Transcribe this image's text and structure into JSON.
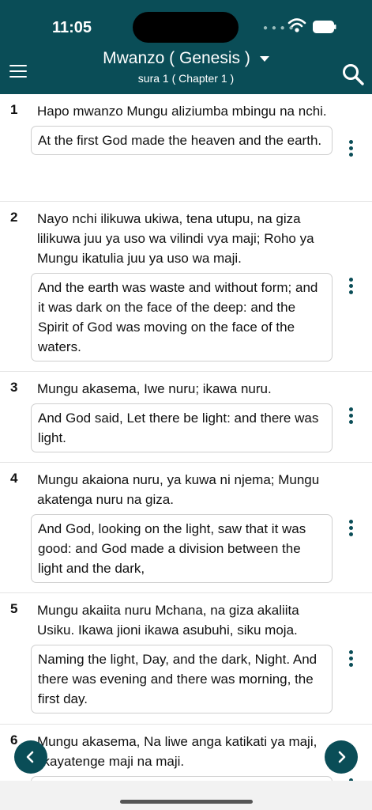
{
  "status": {
    "time": "11:05"
  },
  "header": {
    "book_title": "Mwanzo ( Genesis )",
    "chapter_subtitle": "sura 1 ( Chapter 1 )"
  },
  "icons": {
    "menu": "menu-icon",
    "dropdown": "chevron-down-icon",
    "search": "search-icon",
    "more": "more-vertical-icon",
    "prev": "chevron-left-icon",
    "next": "chevron-right-icon"
  },
  "colors": {
    "accent": "#0a4d57"
  },
  "verses": [
    {
      "num": "1",
      "swahili": "Hapo mwanzo Mungu aliziumba mbingu na nchi.",
      "english": "At the first God made the heaven and the earth."
    },
    {
      "num": "2",
      "swahili": "Nayo nchi ilikuwa ukiwa, tena utupu, na giza lilikuwa juu ya uso wa vilindi vya maji; Roho ya Mungu ikatulia juu ya uso wa maji.",
      "english": "And the earth was waste and without form; and it was dark on the face of the deep: and the Spirit of God was moving on the face of the waters."
    },
    {
      "num": "3",
      "swahili": "Mungu akasema, Iwe nuru; ikawa nuru.",
      "english": "And God said, Let there be light: and there was light."
    },
    {
      "num": "4",
      "swahili": "Mungu akaiona nuru, ya kuwa ni njema; Mungu akatenga nuru na giza.",
      "english": "And God, looking on the light, saw that it was good: and God made a division between the light and the dark,"
    },
    {
      "num": "5",
      "swahili": "Mungu akaiita nuru Mchana, na giza akaliita Usiku. Ikawa jioni ikawa asubuhi, siku moja.",
      "english": "Naming the light, Day, and the dark, Night. And there was evening and there was morning, the first day."
    },
    {
      "num": "6",
      "swahili": "Mungu akasema, Na liwe anga katikati ya maji, likayatenge maji na maji.",
      "english": ""
    }
  ]
}
